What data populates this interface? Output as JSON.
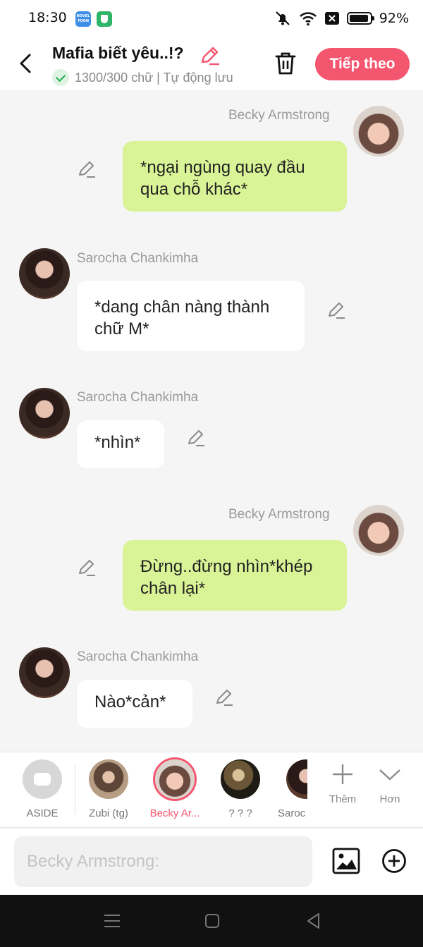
{
  "status_bar": {
    "time": "18:30",
    "app1_text": "NOVEL TOON",
    "battery_percent": "92%"
  },
  "header": {
    "title": "Mafia biết yêu..!?",
    "subtitle": "1300/300 chữ | Tự động lưu",
    "next_label": "Tiếp theo"
  },
  "messages": [
    {
      "speaker": "Becky Armstrong",
      "text": "*ngại ngùng quay đầu qua chỗ khác*",
      "side": "right"
    },
    {
      "speaker": "Sarocha Chankimha",
      "text": "*dang chân nàng thành chữ M*",
      "side": "left"
    },
    {
      "speaker": "Sarocha Chankimha",
      "text": "*nhìn*",
      "side": "left"
    },
    {
      "speaker": "Becky Armstrong",
      "text": "Đừng..đừng nhìn*khép chân lại*",
      "side": "right"
    },
    {
      "speaker": "Sarocha Chankimha",
      "text": "Nào*cản*",
      "side": "left"
    }
  ],
  "characters": [
    {
      "label": "ASIDE"
    },
    {
      "label": "Zubi (tg)"
    },
    {
      "label": "Becky Ar...",
      "selected": true
    },
    {
      "label": "? ? ?"
    },
    {
      "label": "Saroc"
    }
  ],
  "controls": {
    "add_label": "Thêm",
    "more_label": "Hơn"
  },
  "composer": {
    "placeholder": "Becky Armstrong:"
  },
  "colors": {
    "accent": "#f4566f",
    "bubble_right": "#d9f496",
    "bubble_left": "#ffffff",
    "background": "#f5f5f5"
  }
}
